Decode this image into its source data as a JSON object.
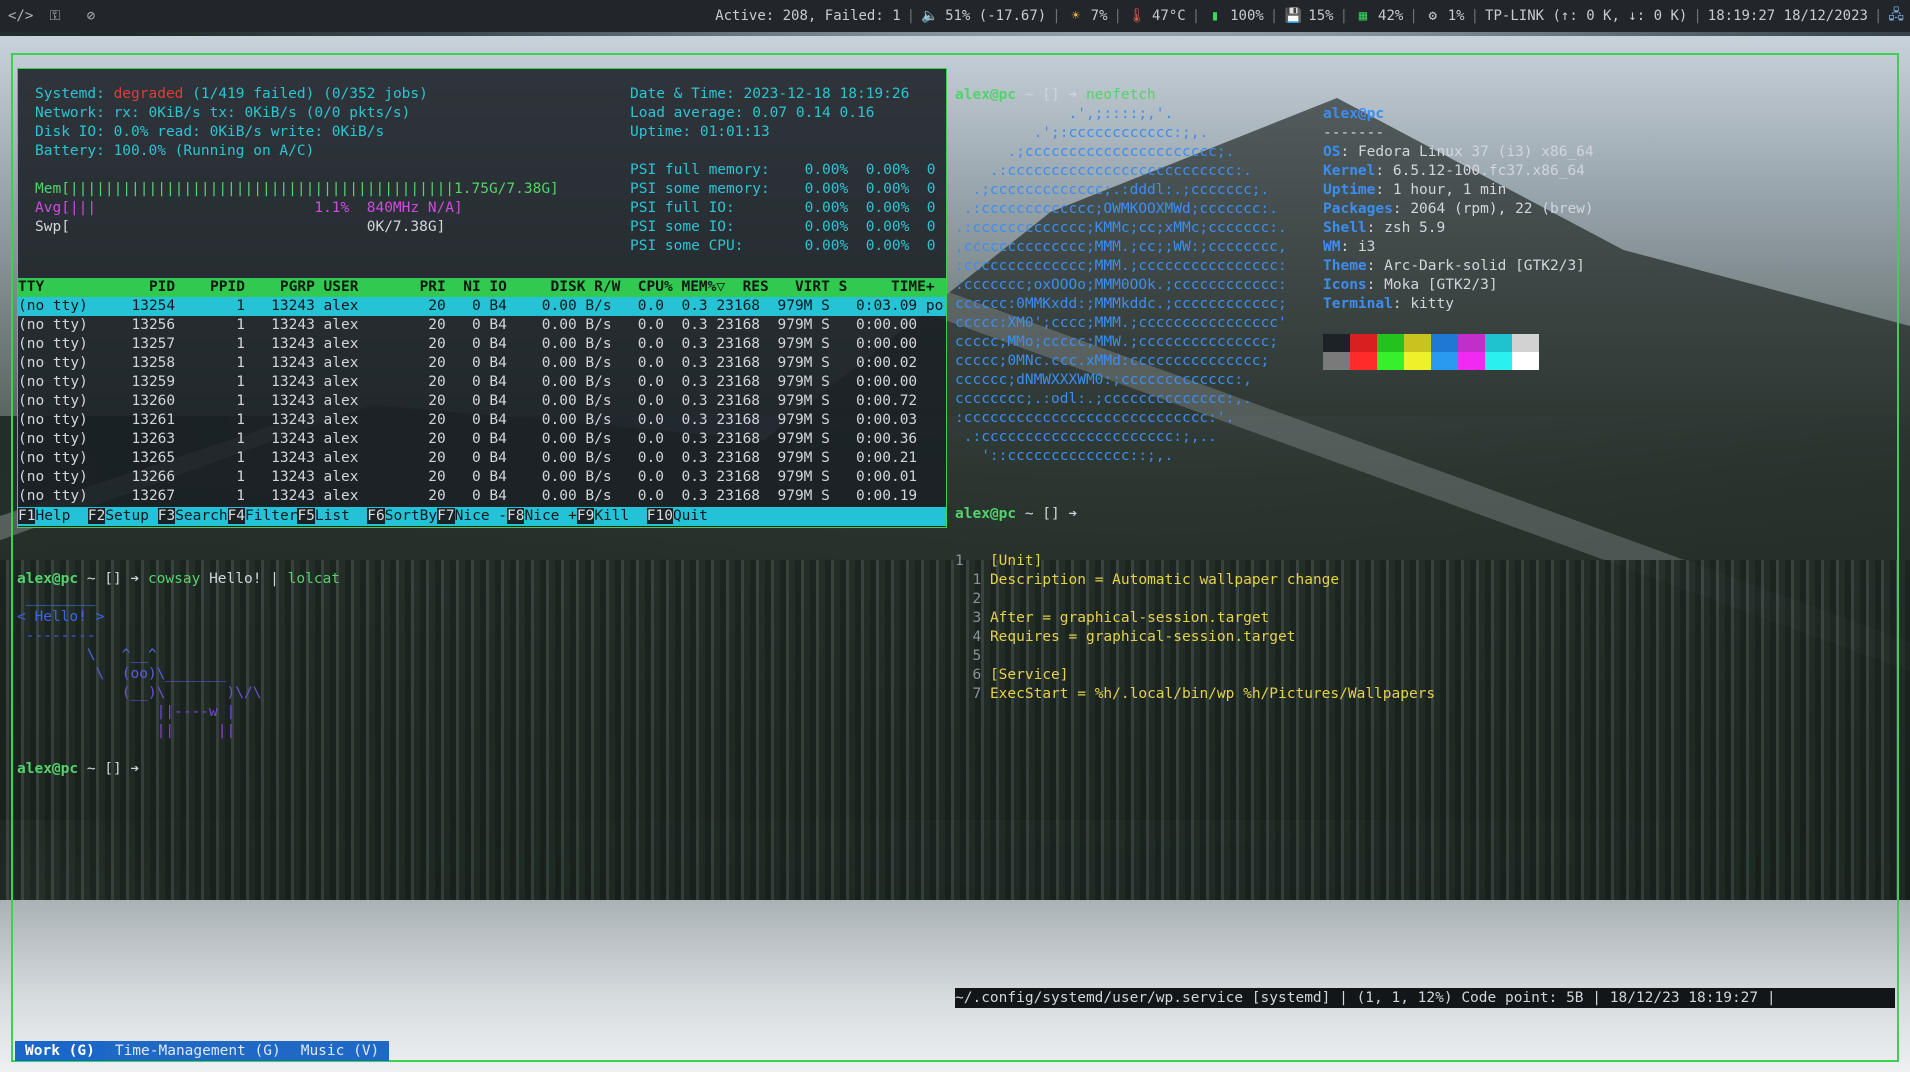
{
  "topbar": {
    "left_icons": [
      "code-icon",
      "key-icon",
      "compass-icon"
    ],
    "status_active": "Active: 208, Failed: 1",
    "volume": "51% (-17.67)",
    "brightness": "7%",
    "temperature": "47°C",
    "battery": "100%",
    "disk": "15%",
    "memory": "42%",
    "cpu": "1%",
    "network": "TP-LINK (↑: 0 K, ↓: 0 K)",
    "clock": "18:19:27 18/12/2023"
  },
  "htop": {
    "systemd_label": "Systemd:",
    "systemd_state": "degraded",
    "systemd_detail": "(1/419 failed) (0/352 jobs)",
    "network_line": "Network: rx: 0KiB/s tx: 0KiB/s (0/0 pkts/s)",
    "diskio_line": "Disk IO: 0.0% read: 0KiB/s write: 0KiB/s",
    "battery_line": "Battery: 100.0% (Running on A/C)",
    "mem_line": "Mem[||||||||||||||||||||||||||||||||||||||||||||1.75G/7.38G]",
    "avg_line": "Avg[|||                         1.1%  840MHz N/A]",
    "swp_line": "Swp[                                  0K/7.38G]",
    "datetime_line": "Date & Time: 2023-12-18 18:19:26",
    "load_line": "Load average: 0.07 0.14 0.16",
    "uptime_line": "Uptime: 01:01:13",
    "psi_lines": [
      "PSI full memory:    0.00%  0.00%  0",
      "PSI some memory:    0.00%  0.00%  0",
      "PSI full IO:        0.00%  0.00%  0",
      "PSI some IO:        0.00%  0.00%  0",
      "PSI some CPU:       0.00%  0.00%  0"
    ],
    "header": "TTY            PID    PPID    PGRP USER       PRI  NI IO     DISK R/W  CPU% MEM%▽  RES   VIRT S     TIME+  Co",
    "rows": [
      "(no tty)     13254       1   13243 alex        20   0 B4    0.00 B/s   0.0  0.3 23168  979M S   0:03.09 po",
      "(no tty)     13256       1   13243 alex        20   0 B4    0.00 B/s   0.0  0.3 23168  979M S   0:00.00 ",
      "(no tty)     13257       1   13243 alex        20   0 B4    0.00 B/s   0.0  0.3 23168  979M S   0:00.00 ",
      "(no tty)     13258       1   13243 alex        20   0 B4    0.00 B/s   0.0  0.3 23168  979M S   0:00.02 ",
      "(no tty)     13259       1   13243 alex        20   0 B4    0.00 B/s   0.0  0.3 23168  979M S   0:00.00 ",
      "(no tty)     13260       1   13243 alex        20   0 B4    0.00 B/s   0.0  0.3 23168  979M S   0:00.72 ",
      "(no tty)     13261       1   13243 alex        20   0 B4    0.00 B/s   0.0  0.3 23168  979M S   0:00.03 ",
      "(no tty)     13263       1   13243 alex        20   0 B4    0.00 B/s   0.0  0.3 23168  979M S   0:00.36 ",
      "(no tty)     13265       1   13243 alex        20   0 B4    0.00 B/s   0.0  0.3 23168  979M S   0:00.21 ",
      "(no tty)     13266       1   13243 alex        20   0 B4    0.00 B/s   0.0  0.3 23168  979M S   0:00.01 ",
      "(no tty)     13267       1   13243 alex        20   0 B4    0.00 B/s   0.0  0.3 23168  979M S   0:00.19 "
    ],
    "footer": [
      {
        "key": "F1",
        "label": "Help  "
      },
      {
        "key": "F2",
        "label": "Setup "
      },
      {
        "key": "F3",
        "label": "Search"
      },
      {
        "key": "F4",
        "label": "Filter"
      },
      {
        "key": "F5",
        "label": "List  "
      },
      {
        "key": "F6",
        "label": "SortBy"
      },
      {
        "key": "F7",
        "label": "Nice -"
      },
      {
        "key": "F8",
        "label": "Nice +"
      },
      {
        "key": "F9",
        "label": "Kill  "
      },
      {
        "key": "F10",
        "label": "Quit"
      }
    ]
  },
  "neofetch": {
    "prompt_user": "alex@pc",
    "prompt_rest": " ~ [] ➔ ",
    "command": "neofetch",
    "title": "alex@pc",
    "underline": "-------",
    "logo": [
      "             .',;::::;,'.",
      "         .';:cccccccccccc:;,.",
      "      .;cccccccccccccccccccccc;.",
      "    .:cccccccccccccccccccccccccc:.",
      "  .;ccccccccccccc;.:dddl:.;ccccccc;.",
      " .:ccccccccccccc;OWMKOOXMWd;ccccccc:.",
      ".:ccccccccccccc;KMMc;cc;xMMc;ccccccc:.",
      ",cccccccccccccc;MMM.;cc;;WW:;cccccccc,",
      ":cccccccccccccc;MMM.;cccccccccccccccc:",
      ":ccccccc;oxOOOo;MMM0OOk.;cccccccccccc:",
      "cccccc:0MMKxdd:;MMMkddc.;cccccccccccc;",
      "ccccc:XM0';cccc;MMM.;cccccccccccccccc'",
      "ccccc;MMo;ccccc;MMW.;ccccccccccccccc;",
      "ccccc;0MNc.ccc.xMMd:ccccccccccccccc;",
      "cccccc;dNMWXXXWM0:;ccccccccccccc:,",
      "cccccccc;.:odl:.;cccccccccccccc:,.",
      ":cccccccccccccccccccccccccccc:'.",
      " .:cccccccccccccccccccccc:;,..",
      "   '::cccccccccccccc::;,."
    ],
    "info": [
      {
        "key": "OS",
        "value": "Fedora Linux 37 (i3) x86_64"
      },
      {
        "key": "Kernel",
        "value": "6.5.12-100.fc37.x86_64"
      },
      {
        "key": "Uptime",
        "value": "1 hour, 1 min"
      },
      {
        "key": "Packages",
        "value": "2064 (rpm), 22 (brew)"
      },
      {
        "key": "Shell",
        "value": "zsh 5.9"
      },
      {
        "key": "WM",
        "value": "i3"
      },
      {
        "key": "Theme",
        "value": "Arc-Dark-solid [GTK2/3]"
      },
      {
        "key": "Icons",
        "value": "Moka [GTK2/3]"
      },
      {
        "key": "Terminal",
        "value": "kitty"
      }
    ],
    "palette_top": [
      "#1c2226",
      "#d91f1f",
      "#23c21f",
      "#c9c21f",
      "#1f78d4",
      "#c22ec9",
      "#1fc2cf",
      "#d2d2d2"
    ],
    "palette_bottom": [
      "#7a7a7a",
      "#ff2a2a",
      "#37f02a",
      "#f0f02a",
      "#2a9af0",
      "#f02af0",
      "#2af0f0",
      "#ffffff"
    ],
    "prompt2_user": "alex@pc",
    "prompt2_rest": " ~ [] ➔"
  },
  "cowsay": {
    "prompt_user": "alex@pc",
    "prompt_rest": " ~ [] ➔ ",
    "cmd1": "cowsay",
    "cmd_arg": " Hello! | ",
    "cmd2": "lolcat",
    "art": [
      " ________",
      "< Hello! >",
      " --------",
      "        \\   ^__^",
      "         \\  (oo)\\_______",
      "            (__)\\       )\\/\\",
      "                ||----w |",
      "                ||     ||"
    ],
    "prompt2_user": "alex@pc",
    "prompt2_rest": " ~ [] ➔"
  },
  "vim": {
    "lines": [
      {
        "num": "1",
        "text": "[Unit]"
      },
      {
        "num": "1",
        "text": "Description = Automatic wallpaper change"
      },
      {
        "num": "2",
        "text": ""
      },
      {
        "num": "3",
        "text": "After = graphical-session.target"
      },
      {
        "num": "4",
        "text": "Requires = graphical-session.target"
      },
      {
        "num": "5",
        "text": ""
      },
      {
        "num": "6",
        "text": "[Service]"
      },
      {
        "num": "7",
        "text": "ExecStart = %h/.local/bin/wp %h/Pictures/Wallpapers"
      }
    ],
    "statusline": "~/.config/systemd/user/wp.service [systemd] | (1, 1, 12%) Code point: 5B | 18/12/23 18:19:27 |"
  },
  "workspaces": [
    {
      "label": "Work (G)"
    },
    {
      "label": "Time-Management (G)"
    },
    {
      "label": "Music (V)"
    }
  ]
}
